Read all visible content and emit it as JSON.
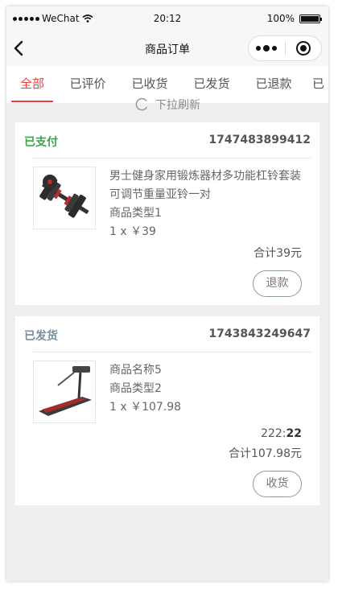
{
  "status_bar": {
    "carrier": "WeChat",
    "time": "20:12",
    "battery": "100%"
  },
  "nav": {
    "title": "商品订单"
  },
  "tabs": [
    {
      "label": "全部",
      "active": true
    },
    {
      "label": "已评价",
      "active": false
    },
    {
      "label": "已收货",
      "active": false
    },
    {
      "label": "已发货",
      "active": false
    },
    {
      "label": "已退款",
      "active": false
    },
    {
      "label": "已",
      "active": false
    }
  ],
  "refresh_hint": "下拉刷新",
  "colors": {
    "accent": "#e64340",
    "paid_status": "#3aa64a",
    "shipped_status": "#7a8c98"
  },
  "orders": [
    {
      "status": "已支付",
      "order_no": "1747483899412",
      "image": "dumbbell-product-image",
      "title": "男士健身家用锻炼器材多功能杠铃套装可调节重量亚铃一对",
      "type": "商品类型1",
      "qty_price": "1 x ￥39",
      "total": "合计39元",
      "action": "退款"
    },
    {
      "status": "已发货",
      "order_no": "1743843249647",
      "image": "treadmill-product-image",
      "title": "商品名称5",
      "type": "商品类型2",
      "qty_price": "1 x ￥107.98",
      "extra_key": "222:",
      "extra_val": "22",
      "total": "合计107.98元",
      "action": "收货"
    }
  ]
}
